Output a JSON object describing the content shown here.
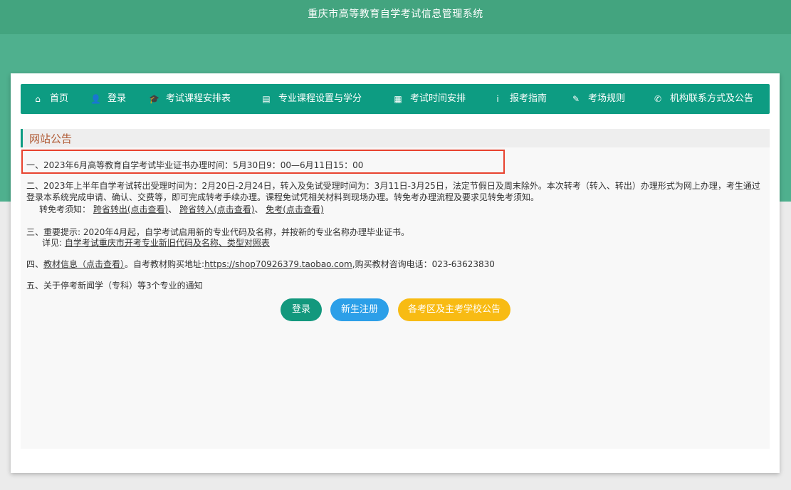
{
  "header": {
    "title": "重庆市高等教育自学考试信息管理系统"
  },
  "nav": {
    "items": [
      {
        "icon": "home-icon",
        "glyph": "⌂",
        "label": "首页"
      },
      {
        "icon": "user-icon",
        "glyph": "👤",
        "label": "登录"
      },
      {
        "icon": "graduation-cap-icon",
        "glyph": "🎓",
        "label": "考试课程安排表"
      },
      {
        "icon": "id-card-icon",
        "glyph": "▤",
        "label": "专业课程设置与学分"
      },
      {
        "icon": "calendar-icon",
        "glyph": "▦",
        "label": "考试时间安排"
      },
      {
        "icon": "info-icon",
        "glyph": "i",
        "label": "报考指南"
      },
      {
        "icon": "pencil-icon",
        "glyph": "✎",
        "label": "考场规则"
      },
      {
        "icon": "phone-icon",
        "glyph": "✆",
        "label": "机构联系方式及公告"
      }
    ]
  },
  "notice": {
    "heading": "网站公告",
    "item1": "一、2023年6月高等教育自学考试毕业证书办理时间：5月30日9：00—6月11日15：00",
    "item2_text": "二、2023年上半年自学考试转出受理时间为：2月20日-2月24日，转入及免试受理时间为：3月11日-3月25日，法定节假日及周末除外。本次转考（转入、转出）办理形式为网上办理，考生通过登录本系统完成申请、确认、交费等，即可完成转考手续办理。课程免试凭相关材料到现场办理。转免考办理流程及要求见转免考须知。",
    "item2_sub_label": "转免考须知：",
    "item2_link1": "跨省转出(点击查看)",
    "item2_sep1": "、",
    "item2_link2": "跨省转入(点击查看)",
    "item2_sep2": "、",
    "item2_link3": "免考(点击查看)",
    "item3_text": "三、重要提示: 2020年4月起，自学考试启用新的专业代码及名称，并按新的专业名称办理毕业证书。",
    "item3_detail_label": "详见:",
    "item3_link": "自学考试重庆市开考专业新旧代码及名称、类型对照表",
    "item4_prefix": "四、",
    "item4_link": "教材信息（点击查看）",
    "item4_mid": "。自考教材购买地址:",
    "item4_url": "https://shop70926379.taobao.com",
    "item4_suffix": ",购买教材咨询电话：023-63623830",
    "item5_text": "五、关于停考新闻学（专科）等3个专业的通知"
  },
  "buttons": {
    "login": "登录",
    "register": "新生注册",
    "exam_notice": "各考区及主考学校公告"
  },
  "colors": {
    "nav_bg": "#0d9c82",
    "header_bg": "#4fb08e",
    "highlight_border": "#e8432f",
    "btn_register": "#2c9fe8",
    "btn_notice": "#f8bb13"
  }
}
